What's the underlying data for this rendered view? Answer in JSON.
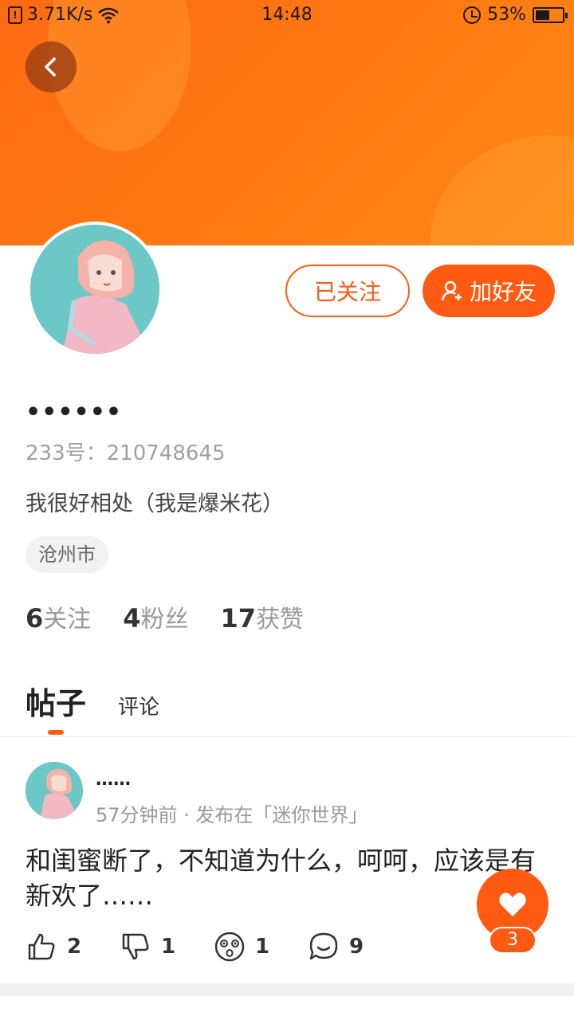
{
  "status_bar": {
    "speed": "3.71K/s",
    "time": "14:48",
    "battery": "53%",
    "battery_level": 0.53
  },
  "profile": {
    "nickname": "••••••",
    "uid": "233号：210748645",
    "bio": "我很好相处（我是爆米花）",
    "location": "沧州市",
    "followed_label": "已关注",
    "add_friend_label": "加好友"
  },
  "stats": [
    {
      "num": "6",
      "label": "关注"
    },
    {
      "num": "4",
      "label": "粉丝"
    },
    {
      "num": "17",
      "label": "获赞"
    }
  ],
  "tabs": {
    "posts": "帖子",
    "comments": "评论"
  },
  "post": {
    "author": "……",
    "meta": "57分钟前 · 发布在「迷你世界」",
    "body": "和闺蜜断了，不知道为什么，呵呵，应该是有新欢了……",
    "likes": "2",
    "dislikes": "1",
    "emoji": "1",
    "comments": "9"
  },
  "floating": {
    "like_count": "3"
  },
  "colors": {
    "accent": "#ff5a12",
    "header": "#ff7a12"
  }
}
